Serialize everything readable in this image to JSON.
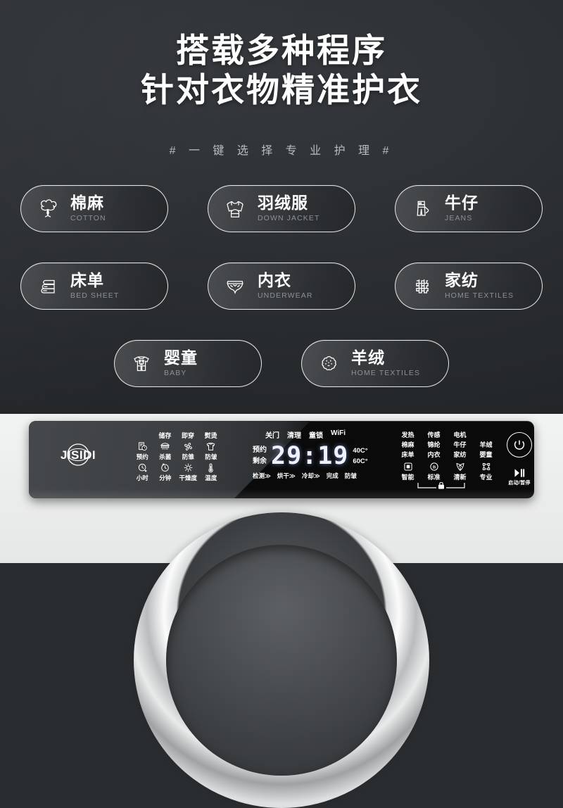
{
  "hero": {
    "headline_line1": "搭载多种程序",
    "headline_line2": "针对衣物精准护衣",
    "subtitle": "# 一 键 选 择 专 业 护 理 #",
    "colors": {
      "background": "#2a2d30",
      "text": "#ffffff",
      "subtitle": "#b9bcc0"
    }
  },
  "programs": [
    {
      "cn": "棉麻",
      "en": "COTTON",
      "icon": "cotton-flower-icon"
    },
    {
      "cn": "羽绒服",
      "en": "DOWN JACKET",
      "icon": "down-jacket-icon"
    },
    {
      "cn": "牛仔",
      "en": "JEANS",
      "icon": "jeans-icon"
    },
    {
      "cn": "床单",
      "en": "BED SHEET",
      "icon": "folded-sheet-icon"
    },
    {
      "cn": "内衣",
      "en": "UNDERWEAR",
      "icon": "underwear-icon"
    },
    {
      "cn": "家纺",
      "en": "HOME TEXTILES",
      "icon": "fabric-weave-icon"
    },
    {
      "cn": "婴童",
      "en": "BABY",
      "icon": "baby-clothes-icon"
    },
    {
      "cn": "羊绒",
      "en": "HOME TEXTILES",
      "icon": "wool-fleece-icon"
    }
  ],
  "panel": {
    "brand": "JISIDI",
    "left_cluster": {
      "top_labels": [
        "储存",
        "即穿",
        "熨烫"
      ],
      "icon_row": [
        {
          "label": "预约",
          "icon": "schedule-icon"
        },
        {
          "label": "杀菌",
          "icon": "sterilize-icon"
        },
        {
          "label": "防雏",
          "icon": "anti-mite-icon"
        },
        {
          "label": "防皱",
          "icon": "anti-wrinkle-shirt-icon"
        }
      ],
      "bottom_row": [
        {
          "label": "小时",
          "icon": "hour-clock-icon"
        },
        {
          "label": "分钟",
          "icon": "minute-clock-icon"
        },
        {
          "label": "干燥度",
          "icon": "dryness-sun-icon"
        },
        {
          "label": "温度",
          "icon": "thermometer-icon"
        }
      ]
    },
    "display": {
      "status_top": [
        "关门",
        "清理",
        "童锁",
        "WiFi"
      ],
      "side_labels": [
        "预约",
        "剩余"
      ],
      "time": "29:19",
      "temperatures": [
        "40C°",
        "60C°"
      ],
      "progress_steps": [
        "检测≫",
        "烘干≫",
        "冷却≫",
        "完成",
        "防皱"
      ]
    },
    "right_cluster": {
      "row1": [
        "发热",
        "传感",
        "电机"
      ],
      "row2": [
        "棉麻",
        "锦纶",
        "牛仔",
        "羊绒"
      ],
      "row3": [
        "床单",
        "内衣",
        "家纺",
        "婴童"
      ],
      "modes": [
        {
          "label": "智能",
          "icon": "smart-square-icon"
        },
        {
          "label": "标准",
          "icon": "standard-b-icon"
        },
        {
          "label": "清新",
          "icon": "fresh-leaf-icon"
        },
        {
          "label": "专业",
          "icon": "professional-icon"
        }
      ],
      "lock_icon": "child-lock-icon"
    },
    "power": {
      "power_icon": "power-icon",
      "start_pause_icon": "play-pause-icon",
      "start_pause_label": "启动/暂停"
    }
  }
}
